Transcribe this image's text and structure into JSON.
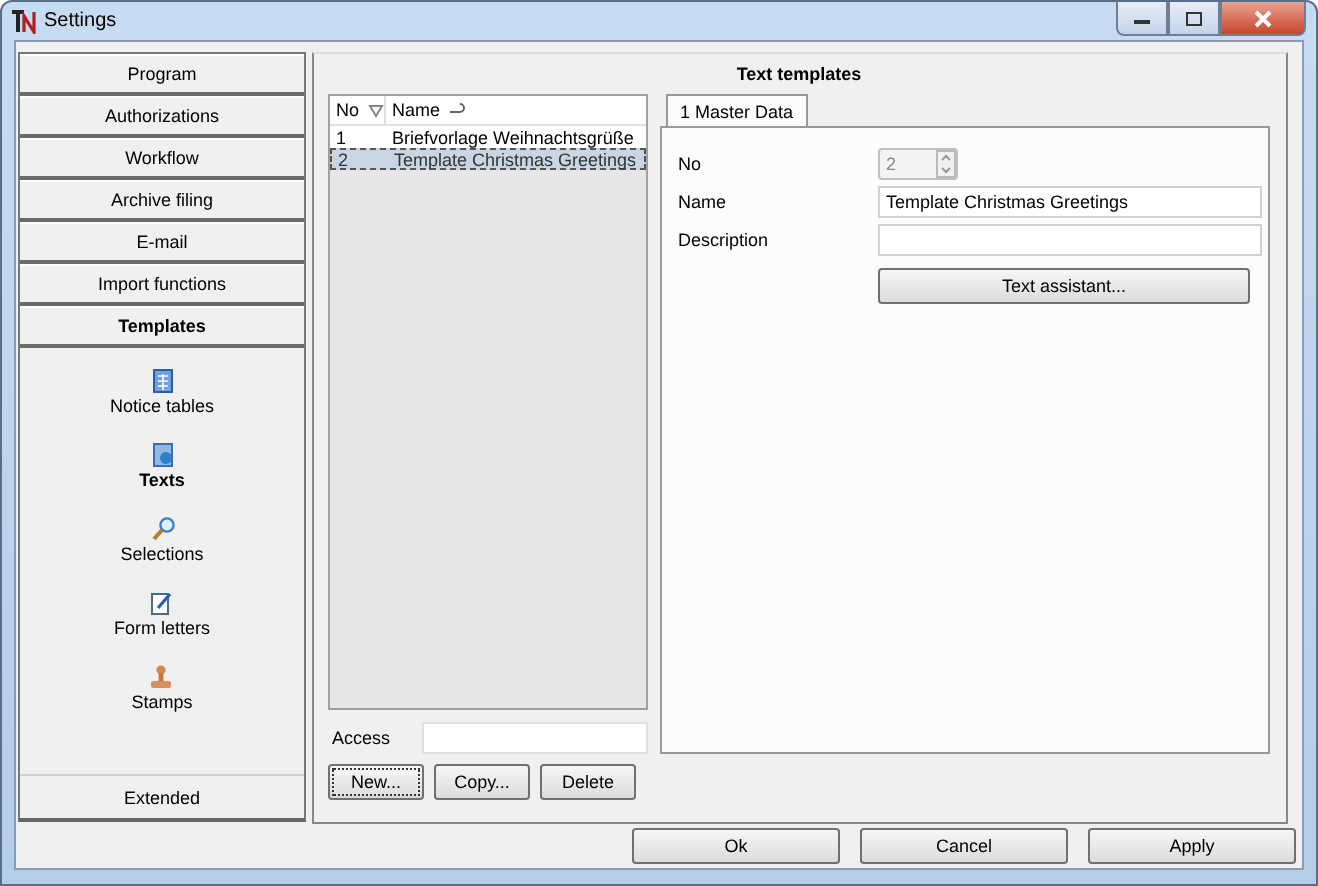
{
  "window": {
    "title": "Settings"
  },
  "nav": {
    "sections": [
      {
        "label": "Program",
        "selected": false
      },
      {
        "label": "Authorizations",
        "selected": false
      },
      {
        "label": "Workflow",
        "selected": false
      },
      {
        "label": "Archive filing",
        "selected": false
      },
      {
        "label": "E-mail",
        "selected": false
      },
      {
        "label": "Import functions",
        "selected": false
      },
      {
        "label": "Templates",
        "selected": true
      }
    ],
    "items": [
      {
        "label": "Notice tables",
        "selected": false
      },
      {
        "label": "Texts",
        "selected": true
      },
      {
        "label": "Selections",
        "selected": false
      },
      {
        "label": "Form letters",
        "selected": false
      },
      {
        "label": "Stamps",
        "selected": false
      }
    ],
    "footer": "Extended"
  },
  "panel": {
    "title": "Text templates"
  },
  "list": {
    "columns": [
      {
        "label": "No"
      },
      {
        "label": "Name"
      }
    ],
    "rows": [
      {
        "no": "1",
        "name": "Briefvorlage Weihnachtsgrüße",
        "selected": false
      },
      {
        "no": "2",
        "name": "Template Christmas Greetings",
        "selected": true
      }
    ]
  },
  "access": {
    "label": "Access"
  },
  "list_buttons": [
    {
      "label": "New...",
      "focused": true
    },
    {
      "label": "Copy...",
      "focused": false
    },
    {
      "label": "Delete",
      "focused": false
    }
  ],
  "tabs": [
    {
      "label": "1 Master Data",
      "selected": true
    }
  ],
  "fields": [
    {
      "label": "No",
      "kind": "spinner",
      "value": "2",
      "disabled": true
    },
    {
      "label": "Name",
      "kind": "text",
      "value": "Template Christmas Greetings"
    },
    {
      "label": "Description",
      "kind": "text"
    }
  ],
  "assistant_button": "Text assistant...",
  "dialog_buttons": [
    "Ok",
    "Cancel",
    "Apply"
  ]
}
